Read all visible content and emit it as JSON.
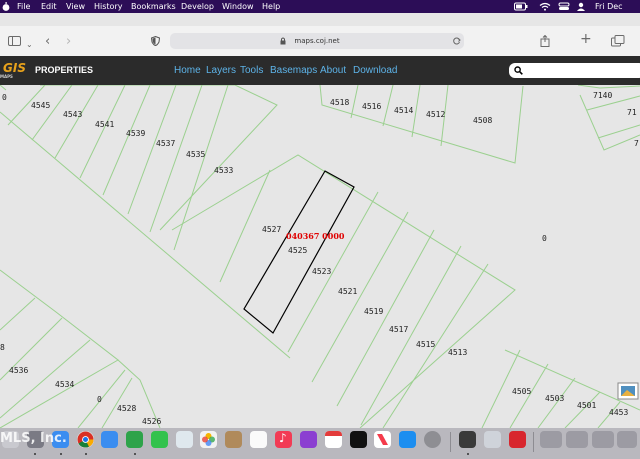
{
  "menubar": {
    "items": [
      "File",
      "Edit",
      "View",
      "History",
      "Bookmarks",
      "Develop",
      "Window",
      "Help"
    ],
    "datetime": "Fri Dec"
  },
  "browser": {
    "url": "maps.coj.net"
  },
  "app": {
    "logo": "GIS",
    "logo_tagline": "MAPS",
    "title": "PROPERTIES",
    "nav": [
      "Home",
      "Layers",
      "Tools",
      "Basemaps",
      "About",
      "Download"
    ]
  },
  "map": {
    "selected_parcel_id": "040367 0000",
    "parcel_labels": [
      "0",
      "4545",
      "4543",
      "4541",
      "4539",
      "4537",
      "4535",
      "4533",
      "4527",
      "4525",
      "4523",
      "4521",
      "4519",
      "4517",
      "4515",
      "4513",
      "4518",
      "4516",
      "4514",
      "4512",
      "4508",
      "7140",
      "71",
      "7",
      "0",
      "8",
      "4536",
      "4534",
      "0",
      "4528",
      "4526",
      "4505",
      "4503",
      "4501",
      "4453"
    ],
    "colors": {
      "parcel_line": "#9bd08f",
      "selection": "#000000",
      "id_text": "#e00000"
    }
  },
  "watermark": "MLS, Inc."
}
